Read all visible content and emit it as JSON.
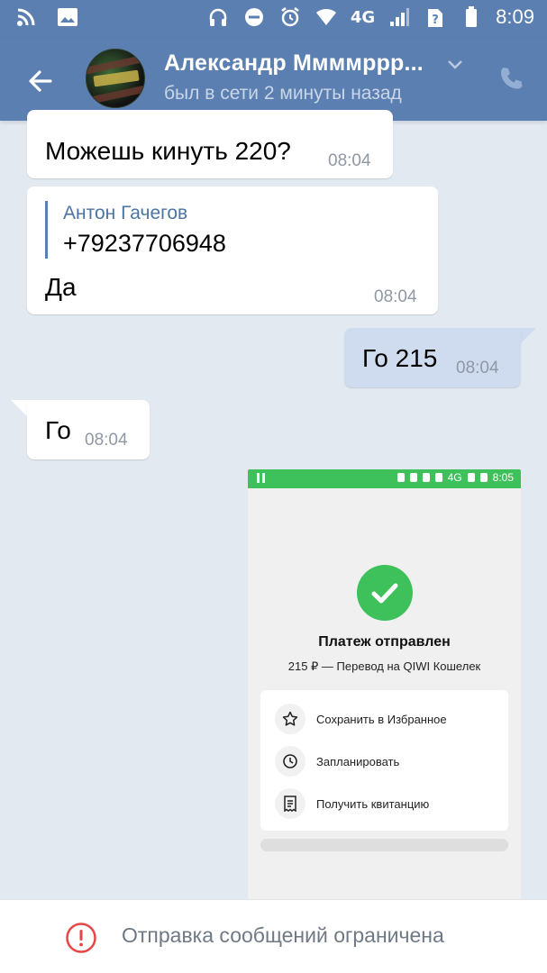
{
  "status_bar": {
    "network": "4G",
    "time": "8:09",
    "icons": [
      "rss-icon",
      "image-icon",
      "headphones-icon",
      "do-not-disturb-icon",
      "alarm-icon",
      "wifi-icon",
      "signal-icon",
      "no-sim-icon",
      "battery-icon"
    ]
  },
  "header": {
    "name": "Александр Ммммррр...",
    "status": "был в сети 2 минуты назад",
    "accent": "#5b7fb0"
  },
  "messages": [
    {
      "direction": "in",
      "text": "Можешь кинуть 220?",
      "time": "08:04"
    },
    {
      "direction": "in",
      "reply_author": "Антон Гачегов",
      "reply_text": "+79237706948",
      "text": "Да",
      "time": "08:04"
    },
    {
      "direction": "out",
      "text": "Го 215",
      "time": "08:04"
    },
    {
      "direction": "in",
      "text": "Го",
      "time": "08:04"
    }
  ],
  "attachment": {
    "status_time": "8:05",
    "status_network": "4G",
    "title": "Платеж отправлен",
    "subtitle": "215 ₽ — Перевод на QIWI Кошелек",
    "actions": [
      {
        "label": "Сохранить в Избранное",
        "icon": "star-icon"
      },
      {
        "label": "Запланировать",
        "icon": "clock-icon"
      },
      {
        "label": "Получить квитанцию",
        "icon": "receipt-icon"
      }
    ],
    "success_color": "#3ec05a"
  },
  "footer": {
    "notice": "Отправка сообщений ограничена",
    "warning_color": "#e64646"
  }
}
